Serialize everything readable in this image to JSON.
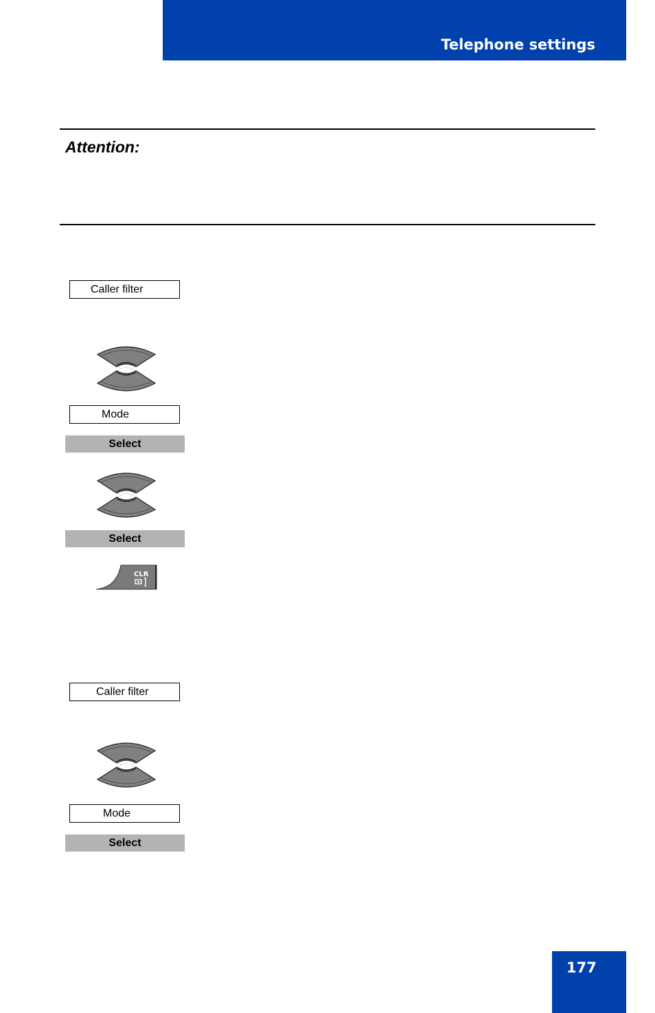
{
  "header": {
    "title": "Telephone settings",
    "band_color": "#0041ad"
  },
  "attention": {
    "label": "Attention:"
  },
  "steps": [
    {
      "type": "display",
      "text": "Caller filter"
    },
    {
      "type": "icon",
      "icon": "navigation-up-down-key-icon"
    },
    {
      "type": "display",
      "text": "Mode"
    },
    {
      "type": "softkey",
      "text": "Select"
    },
    {
      "type": "icon",
      "icon": "navigation-up-down-key-icon"
    },
    {
      "type": "softkey",
      "text": "Select"
    },
    {
      "type": "icon",
      "icon": "clear-key-icon",
      "label": "CLR"
    },
    {
      "type": "display",
      "text": "Caller filter"
    },
    {
      "type": "icon",
      "icon": "navigation-up-down-key-icon"
    },
    {
      "type": "display",
      "text": "Mode"
    },
    {
      "type": "softkey",
      "text": "Select"
    }
  ],
  "footer": {
    "page_number": "177"
  }
}
